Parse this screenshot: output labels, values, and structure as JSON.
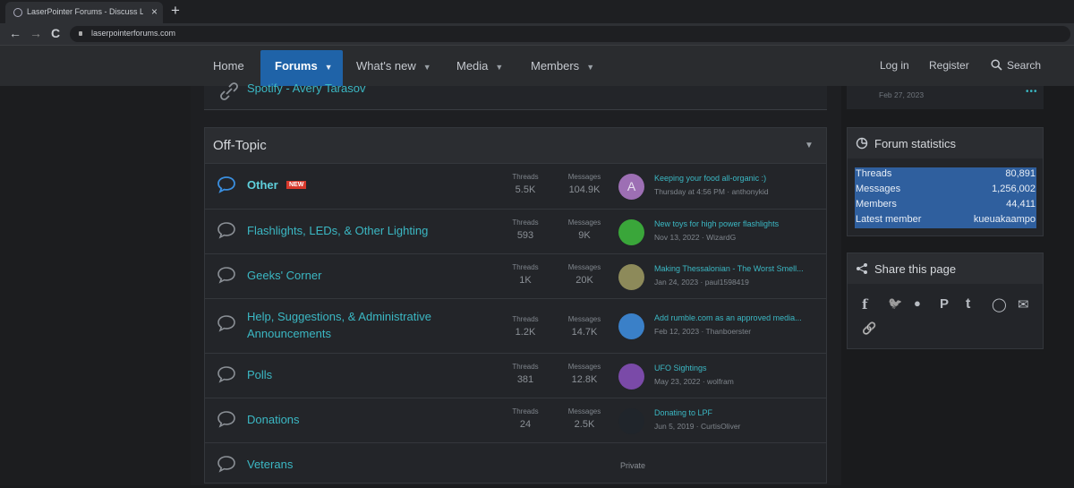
{
  "browser": {
    "tab_title": "LaserPointer Forums - Discuss L",
    "tab_close": "×",
    "new_tab": "+",
    "url": "laserpointerforums.com",
    "back": "←",
    "forward": "→",
    "reload": "C"
  },
  "nav": {
    "home": "Home",
    "forums": "Forums",
    "whats_new": "What's new",
    "media": "Media",
    "members": "Members",
    "login": "Log in",
    "register": "Register",
    "search": "Search",
    "caret": "▼"
  },
  "previous_node": {
    "title": "Spotify - Avery Tarasov"
  },
  "sidebar_previous": {
    "date": "Feb 27, 2023",
    "more": "•••"
  },
  "category": {
    "title": "Off-Topic",
    "collapse": "▼"
  },
  "labels": {
    "threads": "Threads",
    "messages": "Messages"
  },
  "nodes": [
    {
      "title": "Other",
      "badge": "NEW",
      "threads": "5.5K",
      "messages": "104.9K",
      "last_title": "Keeping your food all-organic :)",
      "last_meta": "Thursday at 4:56 PM · anthonykid",
      "avatar_letter": "A",
      "avatar_color": "#9d6fb4"
    },
    {
      "title": "Flashlights, LEDs, & Other Lighting",
      "threads": "593",
      "messages": "9K",
      "last_title": "New toys for high power flashlights",
      "last_meta": "Nov 13, 2022 · WizardG",
      "avatar_color": "#3aa63a"
    },
    {
      "title": "Geeks' Corner",
      "threads": "1K",
      "messages": "20K",
      "last_title": "Making Thessalonian - The Worst Smell...",
      "last_meta": "Jan 24, 2023 · paul1598419",
      "avatar_color": "#8d8a5a"
    },
    {
      "title": "Help, Suggestions, & Administrative Announcements",
      "threads": "1.2K",
      "messages": "14.7K",
      "last_title": "Add rumble.com as an approved media...",
      "last_meta": "Feb 12, 2023 · Thanboerster",
      "avatar_color": "#3a80c8"
    },
    {
      "title": "Polls",
      "threads": "381",
      "messages": "12.8K",
      "last_title": "UFO Sightings",
      "last_meta": "May 23, 2022 · wolfram",
      "avatar_color": "#7a4aa8"
    },
    {
      "title": "Donations",
      "threads": "24",
      "messages": "2.5K",
      "last_title": "Donating to LPF",
      "last_meta": "Jun 5, 2019 · CurtisOliver",
      "avatar_color": "#20252b"
    },
    {
      "title": "Veterans",
      "private": "Private"
    }
  ],
  "forum_statistics": {
    "title": "Forum statistics",
    "rows": [
      {
        "label": "Threads",
        "value": "80,891"
      },
      {
        "label": "Messages",
        "value": "1,256,002"
      },
      {
        "label": "Members",
        "value": "44,411"
      },
      {
        "label": "Latest member",
        "value": "kueuakaampo"
      }
    ]
  },
  "share": {
    "title": "Share this page",
    "icons": [
      "facebook-icon",
      "twitter-icon",
      "reddit-icon",
      "pinterest-icon",
      "tumblr-icon",
      "whatsapp-icon",
      "email-icon",
      "link-icon"
    ]
  }
}
